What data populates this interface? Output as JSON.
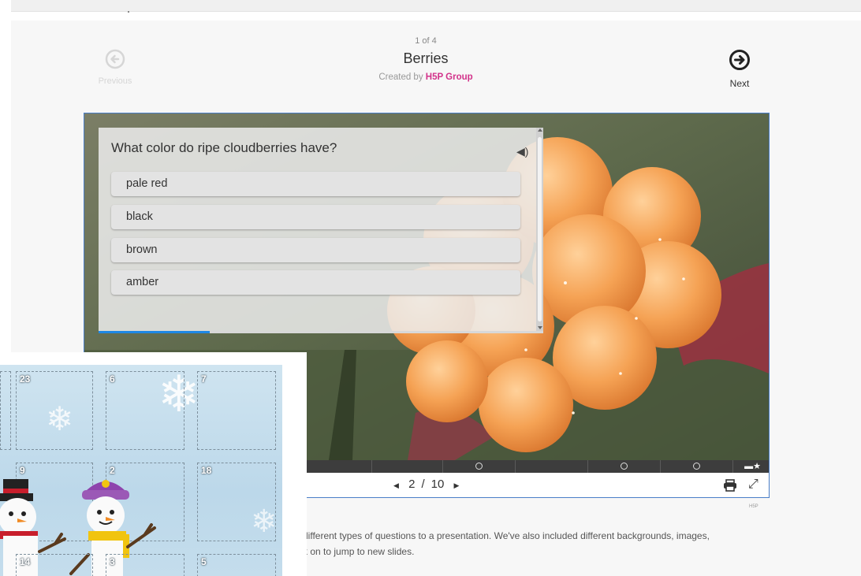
{
  "header": {
    "counter": "1 of 4",
    "title": "Berries",
    "created_prefix": "Created by",
    "author": "H5P Group",
    "prev_label": "Previous",
    "next_label": "Next"
  },
  "quiz": {
    "question": "What color do ripe cloudberries have?",
    "answers": [
      "pale red",
      "black",
      "brown",
      "amber"
    ],
    "progress": 0.25
  },
  "player": {
    "current_slide": "2",
    "separator": "/",
    "total_slides": "10"
  },
  "h5p_mark": "H5P",
  "description": {
    "line1": "different types of questions to a presentation. We've also included different backgrounds, images,",
    "line2": "k on to jump to new slides."
  },
  "advent": {
    "cells": [
      "23",
      "6",
      "7",
      "9",
      "2",
      "18",
      "14",
      "3",
      "5"
    ]
  },
  "icons": {
    "prev": "arrow-left-circle-icon",
    "next": "arrow-right-circle-icon",
    "audio": "speaker-icon",
    "print": "printer-icon",
    "fullscreen": "expand-icon",
    "star": "star-icon"
  },
  "colors": {
    "accent": "#1e88e5",
    "author_link": "#d2328a",
    "frame_border": "#4a7ec8",
    "cloudberry": "#f4a05a"
  }
}
